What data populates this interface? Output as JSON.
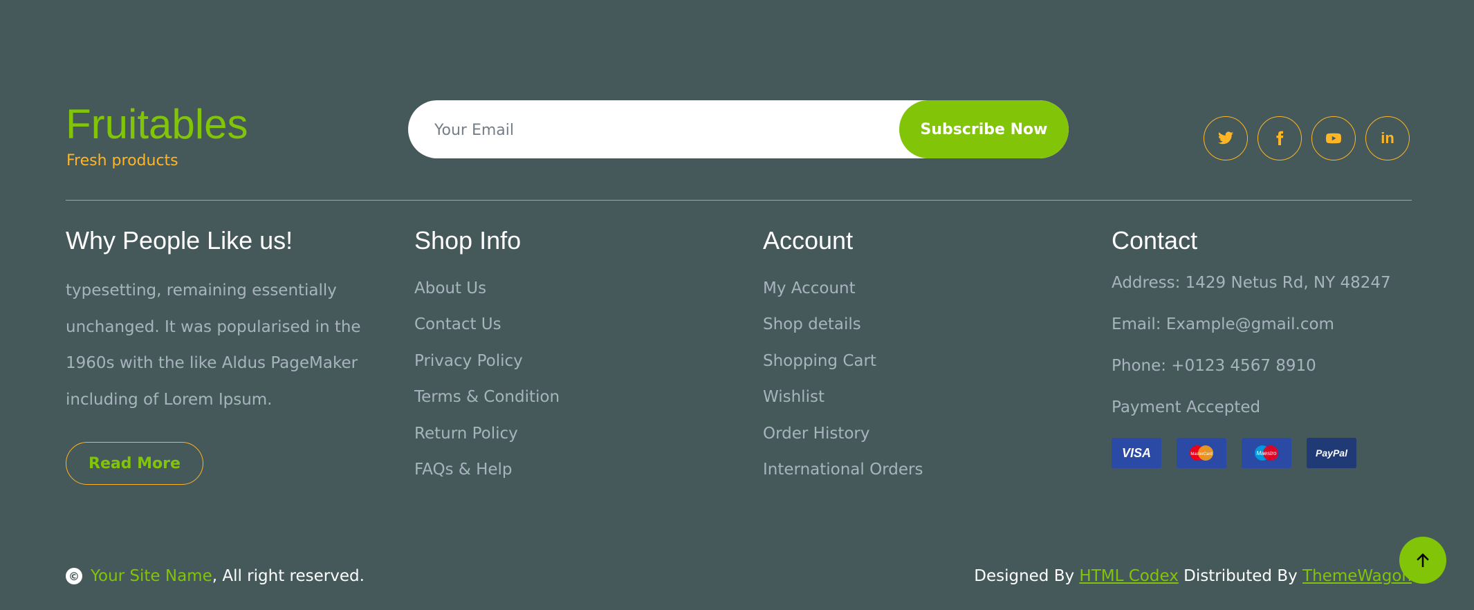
{
  "brand": {
    "title": "Fruitables",
    "subtitle": "Fresh products"
  },
  "newsletter": {
    "placeholder": "Your Email",
    "button_label": "Subscribe Now"
  },
  "social": [
    "twitter-icon",
    "facebook-icon",
    "youtube-icon",
    "linkedin-icon"
  ],
  "columns": {
    "about": {
      "heading": "Why People Like us!",
      "text": "typesetting, remaining essentially unchanged. It was popularised in the 1960s with the like Aldus PageMaker including of Lorem Ipsum.",
      "button_label": "Read More"
    },
    "shop_info": {
      "heading": "Shop Info",
      "links": [
        "About Us",
        "Contact Us",
        "Privacy Policy",
        "Terms & Condition",
        "Return Policy",
        "FAQs & Help"
      ]
    },
    "account": {
      "heading": "Account",
      "links": [
        "My Account",
        "Shop details",
        "Shopping Cart",
        "Wishlist",
        "Order History",
        "International Orders"
      ]
    },
    "contact": {
      "heading": "Contact",
      "address": "Address: 1429 Netus Rd, NY 48247",
      "email": "Email: Example@gmail.com",
      "phone": "Phone: +0123 4567 8910",
      "payment_label": "Payment Accepted",
      "cards": [
        "VISA",
        "MasterCard",
        "Maestro",
        "PayPal"
      ]
    }
  },
  "footer": {
    "copyright_icon": "©",
    "site_name": "Your Site Name",
    "rights": ", All right reserved.",
    "designed_by": "Designed By ",
    "designer": "HTML Codex",
    "distributed_by": " Distributed By ",
    "distributor": "ThemeWagon"
  },
  "colors": {
    "background": "#45595b",
    "primary": "#81c408",
    "secondary": "#ffb524"
  }
}
